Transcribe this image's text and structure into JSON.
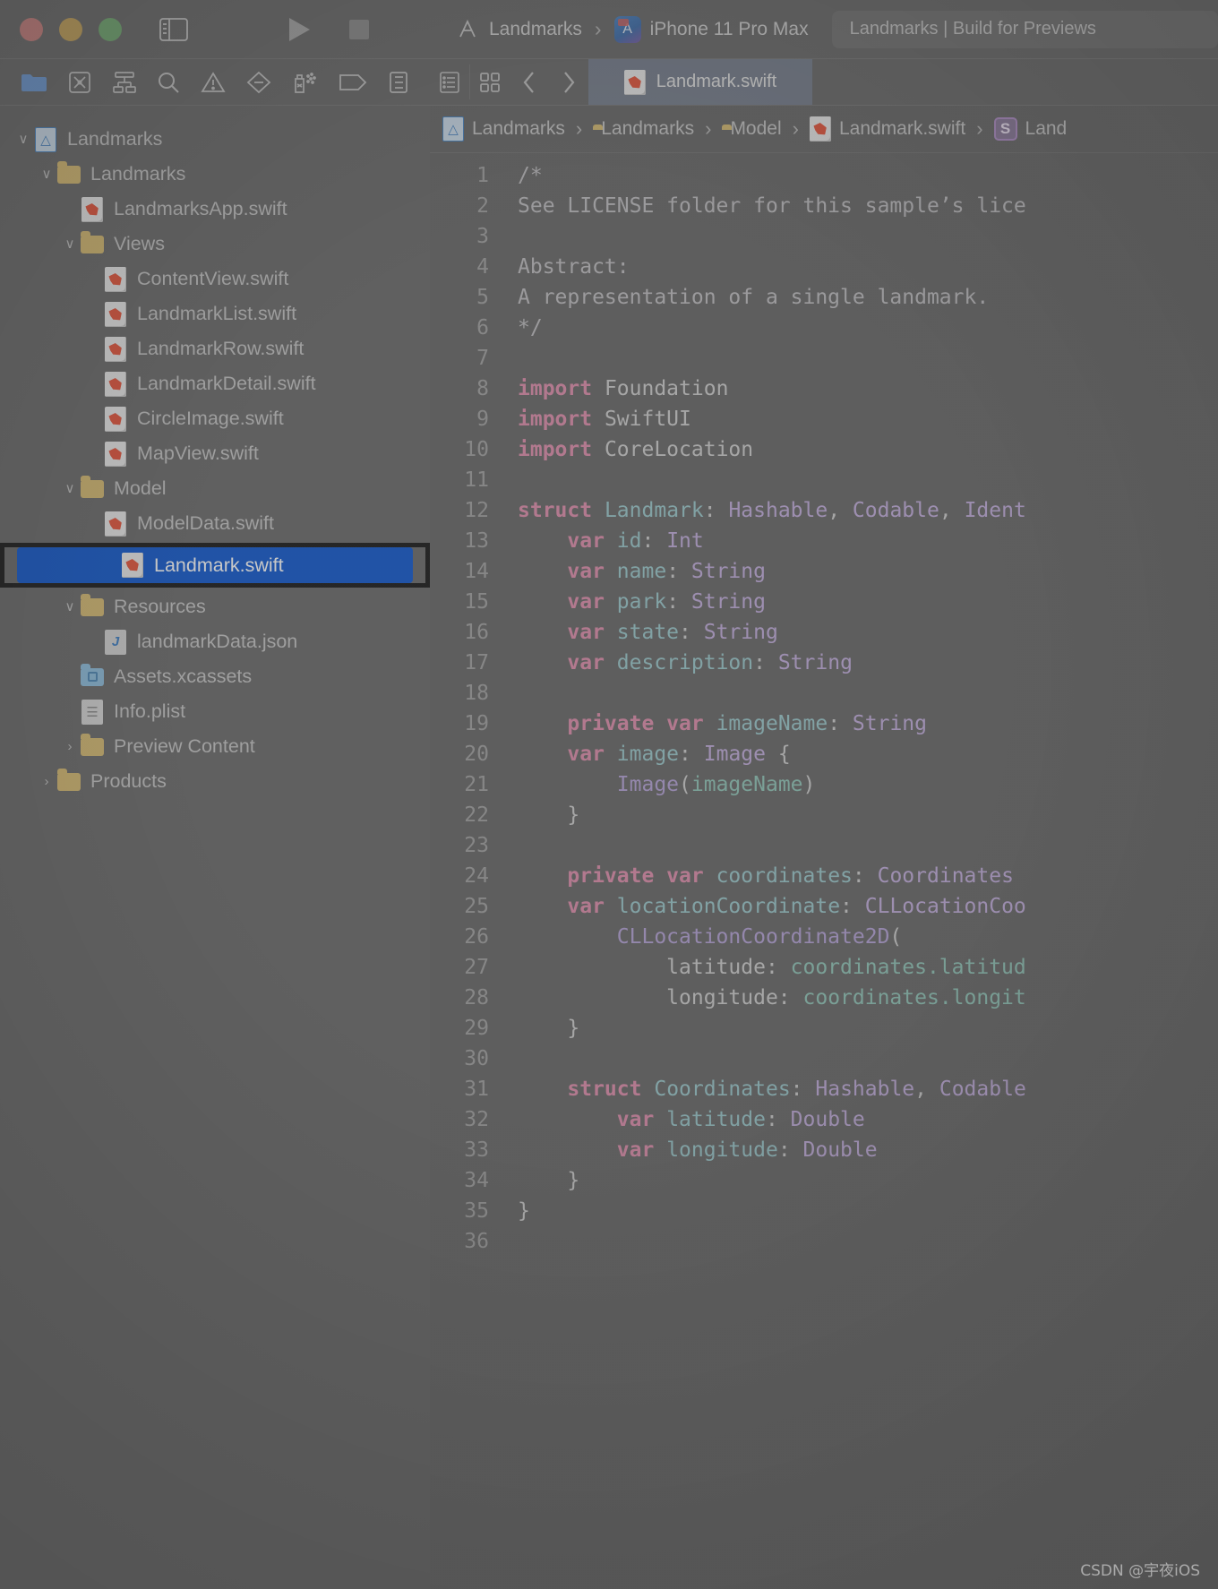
{
  "window": {
    "traffic_lights": [
      "close",
      "minimize",
      "zoom"
    ]
  },
  "toolbar": {
    "sidebar_toggle_icon": "sidebar-toggle-icon",
    "run_icon": "run-play-icon",
    "stop_icon": "stop-square-icon",
    "scheme_name": "Landmarks",
    "scheme_separator": "›",
    "destination_name": "iPhone 11 Pro Max",
    "destination_icon_label": "A",
    "status_text": "Landmarks | Build for Previews"
  },
  "navigator_toolbar": {
    "items": [
      {
        "name": "project-navigator-icon",
        "active": true
      },
      {
        "name": "source-control-navigator-icon",
        "active": false
      },
      {
        "name": "symbol-navigator-icon",
        "active": false
      },
      {
        "name": "find-navigator-icon",
        "active": false
      },
      {
        "name": "issue-navigator-icon",
        "active": false
      },
      {
        "name": "test-navigator-icon",
        "active": false
      },
      {
        "name": "debug-navigator-icon",
        "active": false
      },
      {
        "name": "breakpoint-navigator-icon",
        "active": false
      },
      {
        "name": "report-navigator-icon",
        "active": false
      }
    ]
  },
  "tabbar": {
    "jump_bar_icon": "list-view-icon",
    "grid_icon": "editor-options-icon",
    "back_icon": "‹",
    "forward_icon": "›",
    "active_tab": "Landmark.swift"
  },
  "navigator": {
    "rows": [
      {
        "label": "Landmarks",
        "icon": "xcodeproj",
        "twisty": "∨",
        "indent": 0
      },
      {
        "label": "Landmarks",
        "icon": "folder",
        "twisty": "∨",
        "indent": 1
      },
      {
        "label": "LandmarksApp.swift",
        "icon": "swift",
        "twisty": "",
        "indent": 2
      },
      {
        "label": "Views",
        "icon": "folder",
        "twisty": "∨",
        "indent": 2
      },
      {
        "label": "ContentView.swift",
        "icon": "swift",
        "twisty": "",
        "indent": 3
      },
      {
        "label": "LandmarkList.swift",
        "icon": "swift",
        "twisty": "",
        "indent": 3
      },
      {
        "label": "LandmarkRow.swift",
        "icon": "swift",
        "twisty": "",
        "indent": 3
      },
      {
        "label": "LandmarkDetail.swift",
        "icon": "swift",
        "twisty": "",
        "indent": 3
      },
      {
        "label": "CircleImage.swift",
        "icon": "swift",
        "twisty": "",
        "indent": 3
      },
      {
        "label": "MapView.swift",
        "icon": "swift",
        "twisty": "",
        "indent": 3
      },
      {
        "label": "Model",
        "icon": "folder",
        "twisty": "∨",
        "indent": 2
      },
      {
        "label": "ModelData.swift",
        "icon": "swift",
        "twisty": "",
        "indent": 3
      },
      {
        "label": "Landmark.swift",
        "icon": "swift",
        "twisty": "",
        "indent": 3,
        "selected": true
      },
      {
        "label": "Resources",
        "icon": "folder",
        "twisty": "∨",
        "indent": 2
      },
      {
        "label": "landmarkData.json",
        "icon": "json",
        "twisty": "",
        "indent": 3
      },
      {
        "label": "Assets.xcassets",
        "icon": "assets",
        "twisty": "",
        "indent": 2
      },
      {
        "label": "Info.plist",
        "icon": "plist",
        "twisty": "",
        "indent": 2
      },
      {
        "label": "Preview Content",
        "icon": "folder",
        "twisty": "›",
        "indent": 2
      },
      {
        "label": "Products",
        "icon": "folder",
        "twisty": "›",
        "indent": 1
      }
    ]
  },
  "breadcrumb": {
    "items": [
      {
        "label": "Landmarks",
        "icon": "xcodeproj"
      },
      {
        "label": "Landmarks",
        "icon": "folder"
      },
      {
        "label": "Model",
        "icon": "folder"
      },
      {
        "label": "Landmark.swift",
        "icon": "swift"
      },
      {
        "label": "Land",
        "icon": "symbol"
      }
    ],
    "separator": "›"
  },
  "editor": {
    "line_numbers": [
      1,
      2,
      3,
      4,
      5,
      6,
      7,
      8,
      9,
      10,
      11,
      12,
      13,
      14,
      15,
      16,
      17,
      18,
      19,
      20,
      21,
      22,
      23,
      24,
      25,
      26,
      27,
      28,
      29,
      30,
      31,
      32,
      33,
      34,
      35,
      36
    ],
    "lines": [
      [
        {
          "t": "/*",
          "c": "t-cmt"
        }
      ],
      [
        {
          "t": "See LICENSE folder for this sample’s lice",
          "c": "t-cmt"
        }
      ],
      [],
      [
        {
          "t": "Abstract:",
          "c": "t-cmt"
        }
      ],
      [
        {
          "t": "A representation of a single landmark.",
          "c": "t-cmt"
        }
      ],
      [
        {
          "t": "*/",
          "c": "t-cmt"
        }
      ],
      [],
      [
        {
          "t": "import",
          "c": "t-kw"
        },
        {
          "t": " Foundation",
          "c": "t-pln"
        }
      ],
      [
        {
          "t": "import",
          "c": "t-kw"
        },
        {
          "t": " SwiftUI",
          "c": "t-pln"
        }
      ],
      [
        {
          "t": "import",
          "c": "t-kw"
        },
        {
          "t": " CoreLocation",
          "c": "t-pln"
        }
      ],
      [],
      [
        {
          "t": "struct",
          "c": "t-kw"
        },
        {
          "t": " ",
          "c": "t-pln"
        },
        {
          "t": "Landmark",
          "c": "t-id"
        },
        {
          "t": ": ",
          "c": "t-pln"
        },
        {
          "t": "Hashable",
          "c": "t-type"
        },
        {
          "t": ", ",
          "c": "t-pln"
        },
        {
          "t": "Codable",
          "c": "t-type"
        },
        {
          "t": ", ",
          "c": "t-pln"
        },
        {
          "t": "Ident",
          "c": "t-type"
        }
      ],
      [
        {
          "t": "    ",
          "c": "t-pln"
        },
        {
          "t": "var",
          "c": "t-kw"
        },
        {
          "t": " ",
          "c": "t-pln"
        },
        {
          "t": "id",
          "c": "t-id"
        },
        {
          "t": ": ",
          "c": "t-pln"
        },
        {
          "t": "Int",
          "c": "t-type"
        }
      ],
      [
        {
          "t": "    ",
          "c": "t-pln"
        },
        {
          "t": "var",
          "c": "t-kw"
        },
        {
          "t": " ",
          "c": "t-pln"
        },
        {
          "t": "name",
          "c": "t-id"
        },
        {
          "t": ": ",
          "c": "t-pln"
        },
        {
          "t": "String",
          "c": "t-type"
        }
      ],
      [
        {
          "t": "    ",
          "c": "t-pln"
        },
        {
          "t": "var",
          "c": "t-kw"
        },
        {
          "t": " ",
          "c": "t-pln"
        },
        {
          "t": "park",
          "c": "t-id"
        },
        {
          "t": ": ",
          "c": "t-pln"
        },
        {
          "t": "String",
          "c": "t-type"
        }
      ],
      [
        {
          "t": "    ",
          "c": "t-pln"
        },
        {
          "t": "var",
          "c": "t-kw"
        },
        {
          "t": " ",
          "c": "t-pln"
        },
        {
          "t": "state",
          "c": "t-id"
        },
        {
          "t": ": ",
          "c": "t-pln"
        },
        {
          "t": "String",
          "c": "t-type"
        }
      ],
      [
        {
          "t": "    ",
          "c": "t-pln"
        },
        {
          "t": "var",
          "c": "t-kw"
        },
        {
          "t": " ",
          "c": "t-pln"
        },
        {
          "t": "description",
          "c": "t-id"
        },
        {
          "t": ": ",
          "c": "t-pln"
        },
        {
          "t": "String",
          "c": "t-type"
        }
      ],
      [],
      [
        {
          "t": "    ",
          "c": "t-pln"
        },
        {
          "t": "private var",
          "c": "t-kw"
        },
        {
          "t": " ",
          "c": "t-pln"
        },
        {
          "t": "imageName",
          "c": "t-id"
        },
        {
          "t": ": ",
          "c": "t-pln"
        },
        {
          "t": "String",
          "c": "t-type"
        }
      ],
      [
        {
          "t": "    ",
          "c": "t-pln"
        },
        {
          "t": "var",
          "c": "t-kw"
        },
        {
          "t": " ",
          "c": "t-pln"
        },
        {
          "t": "image",
          "c": "t-id"
        },
        {
          "t": ": ",
          "c": "t-pln"
        },
        {
          "t": "Image",
          "c": "t-type"
        },
        {
          "t": " {",
          "c": "t-pln"
        }
      ],
      [
        {
          "t": "        ",
          "c": "t-pln"
        },
        {
          "t": "Image",
          "c": "t-fn"
        },
        {
          "t": "(",
          "c": "t-pln"
        },
        {
          "t": "imageName",
          "c": "t-prop"
        },
        {
          "t": ")",
          "c": "t-pln"
        }
      ],
      [
        {
          "t": "    }",
          "c": "t-pln"
        }
      ],
      [],
      [
        {
          "t": "    ",
          "c": "t-pln"
        },
        {
          "t": "private var",
          "c": "t-kw"
        },
        {
          "t": " ",
          "c": "t-pln"
        },
        {
          "t": "coordinates",
          "c": "t-id"
        },
        {
          "t": ": ",
          "c": "t-pln"
        },
        {
          "t": "Coordinates",
          "c": "t-type"
        }
      ],
      [
        {
          "t": "    ",
          "c": "t-pln"
        },
        {
          "t": "var",
          "c": "t-kw"
        },
        {
          "t": " ",
          "c": "t-pln"
        },
        {
          "t": "locationCoordinate",
          "c": "t-id"
        },
        {
          "t": ": ",
          "c": "t-pln"
        },
        {
          "t": "CLLocationCoo",
          "c": "t-type"
        }
      ],
      [
        {
          "t": "        ",
          "c": "t-pln"
        },
        {
          "t": "CLLocationCoordinate2D",
          "c": "t-fn"
        },
        {
          "t": "(",
          "c": "t-pln"
        }
      ],
      [
        {
          "t": "            latitude: ",
          "c": "t-pln"
        },
        {
          "t": "coordinates.latitud",
          "c": "t-prop"
        }
      ],
      [
        {
          "t": "            longitude: ",
          "c": "t-pln"
        },
        {
          "t": "coordinates.longit",
          "c": "t-prop"
        }
      ],
      [
        {
          "t": "    }",
          "c": "t-pln"
        }
      ],
      [],
      [
        {
          "t": "    ",
          "c": "t-pln"
        },
        {
          "t": "struct",
          "c": "t-kw"
        },
        {
          "t": " ",
          "c": "t-pln"
        },
        {
          "t": "Coordinates",
          "c": "t-id"
        },
        {
          "t": ": ",
          "c": "t-pln"
        },
        {
          "t": "Hashable",
          "c": "t-type"
        },
        {
          "t": ", ",
          "c": "t-pln"
        },
        {
          "t": "Codable",
          "c": "t-type"
        }
      ],
      [
        {
          "t": "        ",
          "c": "t-pln"
        },
        {
          "t": "var",
          "c": "t-kw"
        },
        {
          "t": " ",
          "c": "t-pln"
        },
        {
          "t": "latitude",
          "c": "t-id"
        },
        {
          "t": ": ",
          "c": "t-pln"
        },
        {
          "t": "Double",
          "c": "t-type"
        }
      ],
      [
        {
          "t": "        ",
          "c": "t-pln"
        },
        {
          "t": "var",
          "c": "t-kw"
        },
        {
          "t": " ",
          "c": "t-pln"
        },
        {
          "t": "longitude",
          "c": "t-id"
        },
        {
          "t": ": ",
          "c": "t-pln"
        },
        {
          "t": "Double",
          "c": "t-type"
        }
      ],
      [
        {
          "t": "    }",
          "c": "t-pln"
        }
      ],
      [
        {
          "t": "}",
          "c": "t-pln"
        }
      ],
      []
    ]
  },
  "watermark": {
    "text": "CSDN @宇夜iOS"
  },
  "colors": {
    "selection_blue": "#1159cf",
    "highlight_border": "#191919",
    "tab_active": "#78808f",
    "window_bg": "#6b6b6b",
    "swift_icon": "#e8553c"
  }
}
